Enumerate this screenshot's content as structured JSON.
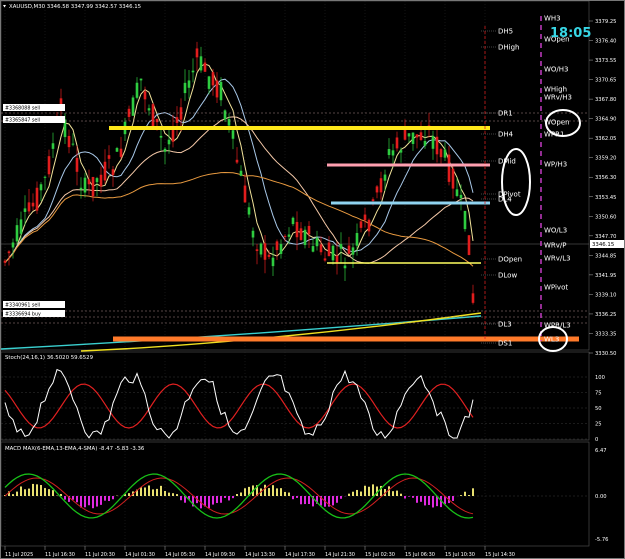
{
  "symbol_header": "XAUUSD,M30 3346.58 3347.99 3342.57 3346.15",
  "timer": "18:05",
  "stoch_header": "Stoch(24,16,1) 36.5020 59.6529",
  "macd_header": "MACD MAX(6-EMA,13-EMA,4-SMA) -8.47 -5.83 -3.36",
  "price_axis": [
    "3379.25",
    "3376.40",
    "3373.55",
    "3370.65",
    "3367.80",
    "3364.90",
    "3362.05",
    "3359.20",
    "3356.30",
    "3353.45",
    "3350.60",
    "3347.70",
    "3344.85",
    "3341.95",
    "3339.10",
    "3336.25",
    "3333.35",
    "3330.50"
  ],
  "current_price": "3346.15",
  "stoch_axis": [
    "100",
    "75",
    "50",
    "25",
    "0"
  ],
  "macd_axis": [
    "6.47",
    "0.00",
    "-5.76"
  ],
  "time_axis": [
    "11 Jul 2025",
    "11 Jul 16:30",
    "11 Jul 20:30",
    "14 Jul 01:30",
    "14 Jul 05:30",
    "14 Jul 09:30",
    "14 Jul 13:30",
    "14 Jul 17:30",
    "14 Jul 21:30",
    "15 Jul 02:30",
    "15 Jul 06:30",
    "15 Jul 10:30",
    "15 Jul 14:30"
  ],
  "left_tags": [
    "#3368088 sell",
    "#3365847 sell",
    "#3340961 sell",
    "#3336694 buy"
  ],
  "daily_levels": [
    "DH5",
    "DHigh",
    "DR1",
    "DH4",
    "DMid",
    "DPivot",
    "DL4",
    "DOpen",
    "DLow",
    "DL3",
    "DS1"
  ],
  "weekly_levels": [
    "WH3",
    "WOpen",
    "WO/H3",
    "WHigh",
    "WRv/H3",
    "WOpen",
    "WPR1",
    "WP/H3",
    "WO/L3",
    "WRv/P",
    "WRv/L3",
    "WPivot",
    "WPR/L3",
    "WL3"
  ],
  "colors": {
    "background": "#000000",
    "bull": "#2ecc40",
    "bear": "#e11d1d",
    "yellow_level": "#ffe81a",
    "pink_level": "#ff9fb0",
    "lightblue_level": "#8fd3f0",
    "orange_level": "#ff7a2a",
    "circle": "#ffffff",
    "timer": "#38d7e6",
    "stoch_main": "#ffffff",
    "stoch_signal": "#e02020",
    "macd_hist_pos": "#e8e070",
    "macd_hist_neg": "#e02ae0",
    "macd_main": "#18c018",
    "macd_signal": "#d02020"
  }
}
